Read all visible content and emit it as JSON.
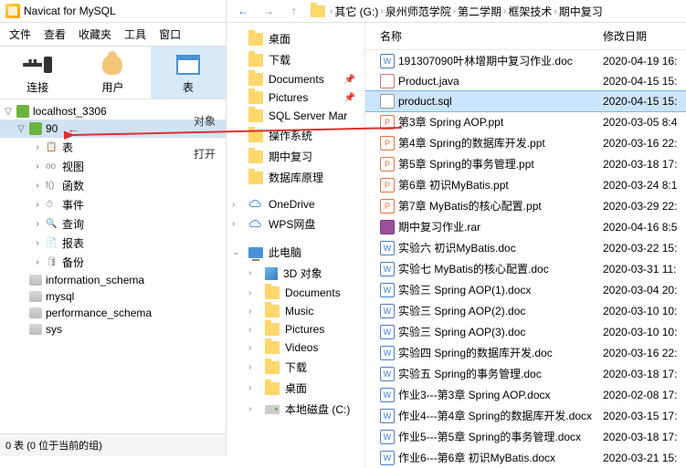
{
  "navicat": {
    "title": "Navicat for MySQL",
    "menu": [
      "文件",
      "查看",
      "收藏夹",
      "工具",
      "窗口"
    ],
    "toolbar": [
      {
        "label": "连接",
        "icon": "plug-icon"
      },
      {
        "label": "用户",
        "icon": "user-icon"
      },
      {
        "label": "表",
        "icon": "table-icon",
        "active": true
      }
    ],
    "tree": {
      "conn": "localhost_3306",
      "db_open": "90",
      "children": [
        "表",
        "视图",
        "函数",
        "事件",
        "查询",
        "报表",
        "备份"
      ],
      "child_icons": [
        "📋",
        "oo",
        "f()",
        "⏱",
        "🔍",
        "📄",
        "🛢"
      ],
      "other_dbs": [
        "information_schema",
        "mysql",
        "performance_schema",
        "sys"
      ]
    },
    "status": "0 表 (0 位于当前的组)",
    "side_labels": [
      "对象",
      "打开"
    ]
  },
  "explorer": {
    "breadcrumb": [
      "其它 (G:)",
      "泉州师范学院",
      "第二学期",
      "框架技术",
      "期中复习"
    ],
    "nav_items_pinned": [
      {
        "label": "桌面",
        "icon": "folder"
      },
      {
        "label": "下载",
        "icon": "folder"
      },
      {
        "label": "Documents",
        "icon": "folder",
        "pinned": true
      },
      {
        "label": "Pictures",
        "icon": "folder",
        "pinned": true
      },
      {
        "label": "SQL Server Mar",
        "icon": "folder"
      },
      {
        "label": "操作系统",
        "icon": "folder"
      },
      {
        "label": "期中复习",
        "icon": "folder"
      },
      {
        "label": "数据库原理",
        "icon": "folder"
      }
    ],
    "nav_clouds": [
      {
        "label": "OneDrive",
        "icon": "cloud-blue"
      },
      {
        "label": "WPS网盘",
        "icon": "cloud-outline"
      }
    ],
    "nav_pc": {
      "label": "此电脑",
      "items": [
        {
          "label": "3D 对象",
          "icon": "cube"
        },
        {
          "label": "Documents",
          "icon": "folder"
        },
        {
          "label": "Music",
          "icon": "folder"
        },
        {
          "label": "Pictures",
          "icon": "folder"
        },
        {
          "label": "Videos",
          "icon": "folder"
        },
        {
          "label": "下载",
          "icon": "folder"
        },
        {
          "label": "桌面",
          "icon": "folder"
        },
        {
          "label": "本地磁盘 (C:)",
          "icon": "drive"
        }
      ]
    },
    "columns": {
      "name": "名称",
      "date": "修改日期"
    },
    "files": [
      {
        "name": "191307090叶林增期中复习作业.doc",
        "date": "2020-04-19 16:",
        "type": "doc"
      },
      {
        "name": "Product.java",
        "date": "2020-04-15 15:",
        "type": "java"
      },
      {
        "name": "product.sql",
        "date": "2020-04-15 15:",
        "type": "sql",
        "selected": true
      },
      {
        "name": "第3章 Spring AOP.ppt",
        "date": "2020-03-05 8:4",
        "type": "ppt"
      },
      {
        "name": "第4章 Spring的数据库开发.ppt",
        "date": "2020-03-16 22:",
        "type": "ppt"
      },
      {
        "name": "第5章 Spring的事务管理.ppt",
        "date": "2020-03-18 17:",
        "type": "ppt"
      },
      {
        "name": "第6章 初识MyBatis.ppt",
        "date": "2020-03-24 8:1",
        "type": "ppt"
      },
      {
        "name": "第7章 MyBatis的核心配置.ppt",
        "date": "2020-03-29 22:",
        "type": "ppt"
      },
      {
        "name": "期中复习作业.rar",
        "date": "2020-04-16 8:5",
        "type": "rar"
      },
      {
        "name": "实验六 初识MyBatis.doc",
        "date": "2020-03-22 15:",
        "type": "doc"
      },
      {
        "name": "实验七 MyBatis的核心配置.doc",
        "date": "2020-03-31 11:",
        "type": "doc"
      },
      {
        "name": "实验三 Spring AOP(1).docx",
        "date": "2020-03-04 20:",
        "type": "doc"
      },
      {
        "name": "实验三 Spring AOP(2).doc",
        "date": "2020-03-10 10:",
        "type": "doc"
      },
      {
        "name": "实验三 Spring AOP(3).doc",
        "date": "2020-03-10 10:",
        "type": "doc"
      },
      {
        "name": "实验四 Spring的数据库开发.doc",
        "date": "2020-03-16 22:",
        "type": "doc"
      },
      {
        "name": "实验五 Spring的事务管理.doc",
        "date": "2020-03-18 17:",
        "type": "doc"
      },
      {
        "name": "作业3---第3章 Spring AOP.docx",
        "date": "2020-02-08 17:",
        "type": "doc"
      },
      {
        "name": "作业4---第4章 Spring的数据库开发.docx",
        "date": "2020-03-15 17:",
        "type": "doc"
      },
      {
        "name": "作业5---第5章 Spring的事务管理.docx",
        "date": "2020-03-18 17:",
        "type": "doc"
      },
      {
        "name": "作业6---第6章 初识MyBatis.docx",
        "date": "2020-03-21 15:",
        "type": "doc"
      }
    ]
  }
}
